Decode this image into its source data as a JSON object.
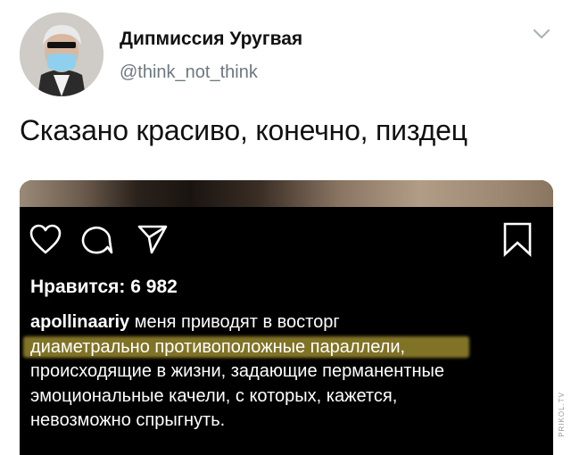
{
  "author": {
    "name": "Дипмиссия Уругвая",
    "handle": "@think_not_think",
    "avatar_icon": "avatar-man-with-mask"
  },
  "tweet": {
    "text": "Сказано красиво, конечно, пиздец"
  },
  "post": {
    "likes": "Нравится: 6 982",
    "username": "apollinaariy",
    "caption_lines": [
      "меня приводят в восторг",
      "диаметрально противоположные параллели,",
      "происходящие в жизни, задающие перманентные",
      "эмоциональные качели, с которых, кажется,",
      "невозможно спрыгнуть."
    ],
    "icons": [
      "heart-icon",
      "comment-icon",
      "share-icon",
      "bookmark-icon"
    ]
  },
  "watermark": "PRIKOL.TV",
  "colors": {
    "handle_gray": "#6e7780",
    "highlight": "#ebd246"
  }
}
